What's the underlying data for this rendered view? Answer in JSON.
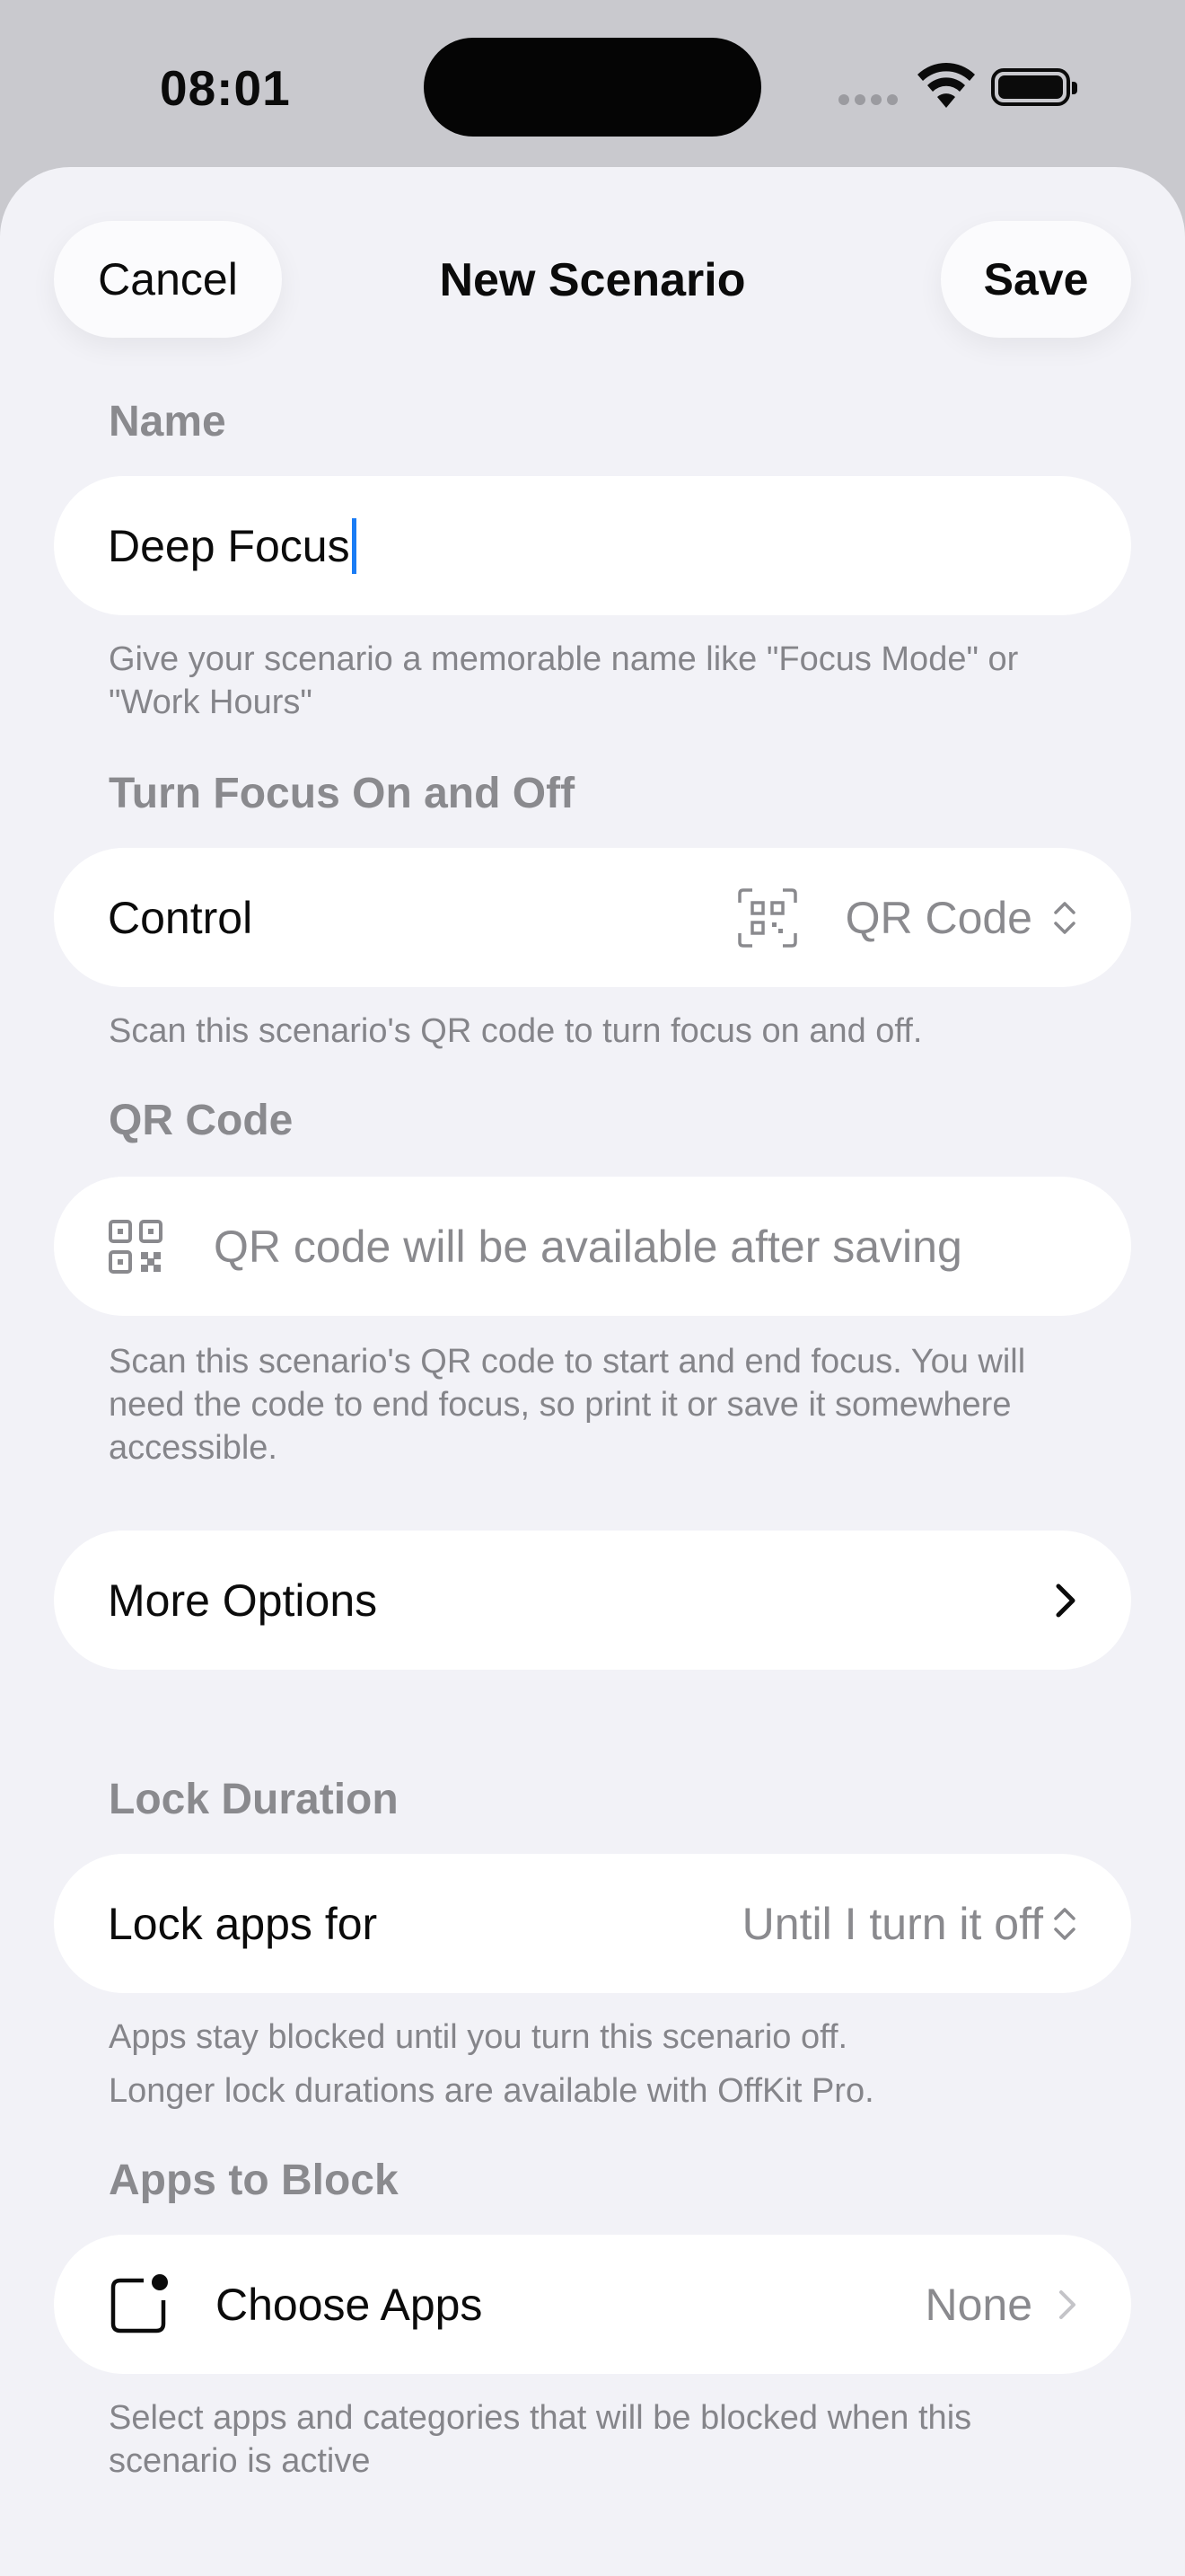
{
  "status_bar": {
    "time": "08:01"
  },
  "sheet": {
    "title": "New Scenario",
    "cancel_label": "Cancel",
    "save_label": "Save"
  },
  "name_section": {
    "label": "Name",
    "value": "Deep Focus",
    "footer": "Give your scenario a memorable name like \"Focus Mode\" or \"Work Hours\""
  },
  "focus_section": {
    "label": "Turn Focus On and Off",
    "row_label": "Control",
    "row_value": "QR Code",
    "footer": "Scan this scenario's QR code to turn focus on and off."
  },
  "qr_section": {
    "label": "QR Code",
    "placeholder": "QR code will be available after saving",
    "footer": "Scan this scenario's QR code to start and end focus. You will need the code to end focus, so print it or save it somewhere accessible."
  },
  "more_options": {
    "label": "More Options"
  },
  "lock_section": {
    "label": "Lock Duration",
    "row_label": "Lock apps for",
    "row_value": "Until I turn it off",
    "footer_line1": "Apps stay blocked until you turn this scenario off.",
    "footer_line2": "Longer lock durations are available with OffKit Pro."
  },
  "apps_section": {
    "label": "Apps to Block",
    "row_label": "Choose Apps",
    "row_value": "None",
    "footer": "Select apps and categories that will be blocked when this scenario is active"
  },
  "colors": {
    "sheet_background": "#f2f2f7",
    "card_background": "#ffffff",
    "accent_caret": "#1a7cf5",
    "secondary_text": "#8a8a8e"
  },
  "icons": [
    "qr-code-icon",
    "chevron-up-down-icon",
    "chevron-right-icon",
    "app-badge-icon",
    "wifi-icon",
    "battery-icon",
    "cellular-signal-icon"
  ]
}
